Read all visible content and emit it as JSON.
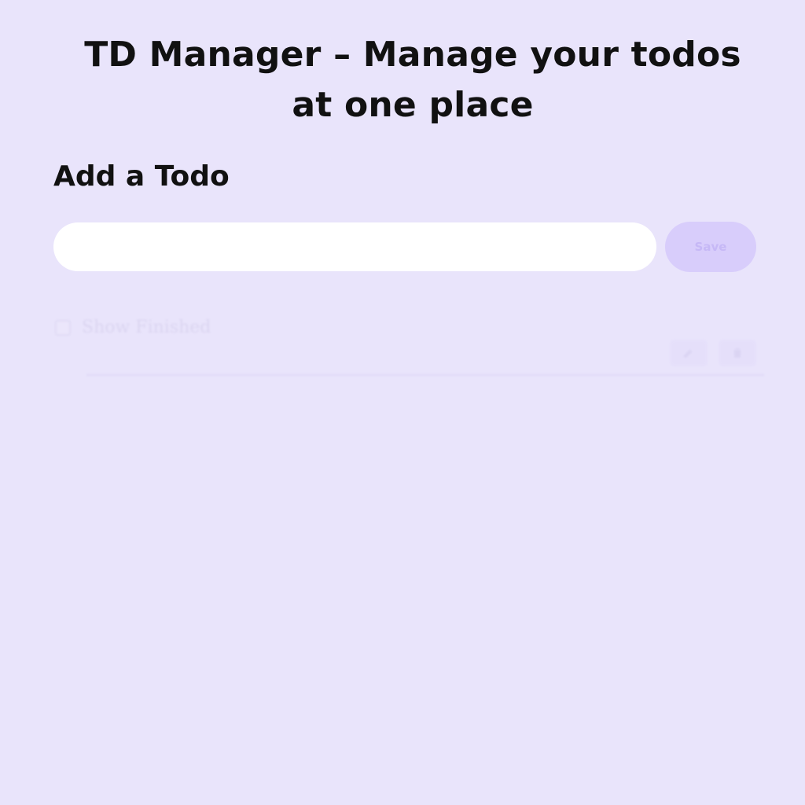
{
  "header": {
    "title": "TD Manager – Manage your todos at one place"
  },
  "add_todo": {
    "heading": "Add a Todo",
    "input_value": "",
    "input_placeholder": "",
    "save_label": "Save"
  },
  "filters": {
    "show_finished_label": "Show Finished",
    "show_finished_checked": false
  },
  "todo_actions": {
    "edit_icon": "edit-icon",
    "delete_icon": "delete-icon"
  },
  "colors": {
    "background": "#e9e4fb",
    "accent": "#d8cdfb",
    "text": "#111111"
  }
}
